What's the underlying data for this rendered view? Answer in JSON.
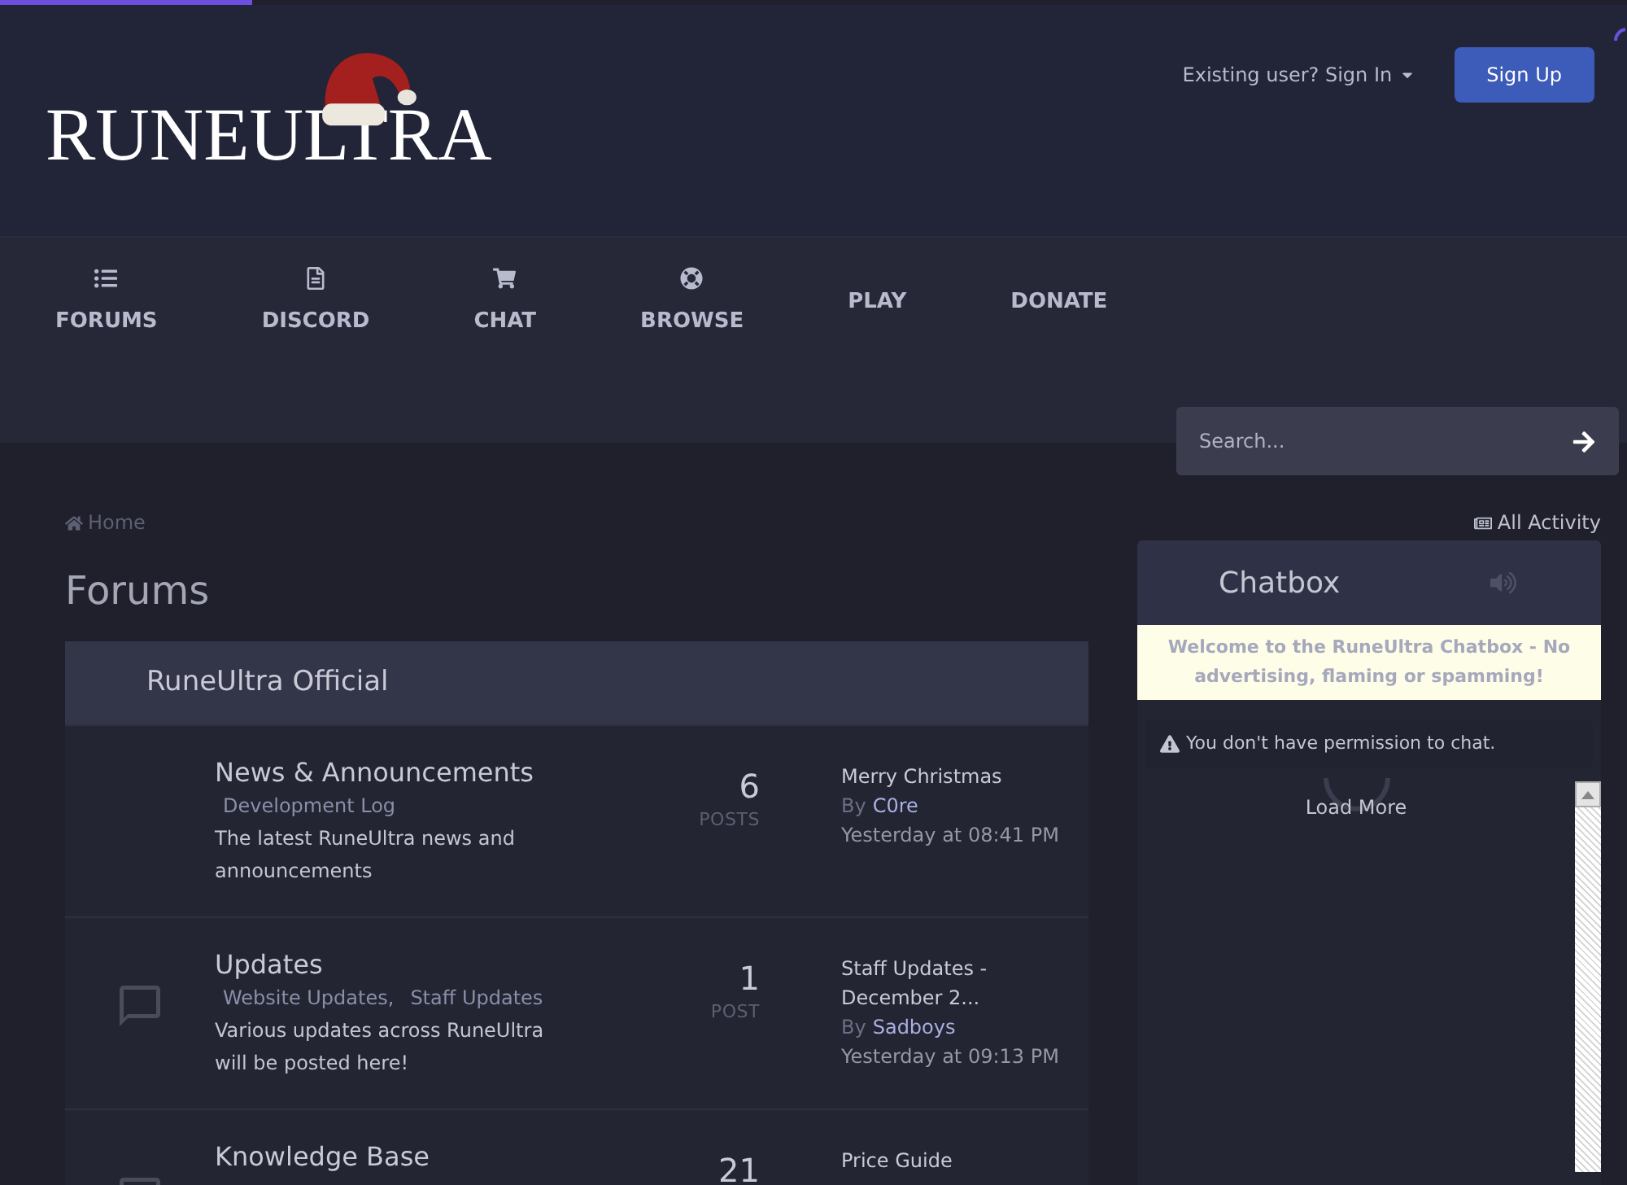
{
  "loading_bar": {
    "level": 0.155
  },
  "header": {
    "logo": "RUNEULTRA",
    "sign_in": "Existing user? Sign In",
    "sign_up": "Sign Up"
  },
  "nav": [
    {
      "label": "FORUMS",
      "kind": "icon"
    },
    {
      "label": "DISCORD",
      "kind": "icon"
    },
    {
      "label": "CHAT",
      "kind": "icon"
    },
    {
      "label": "BROWSE",
      "kind": "icon"
    },
    {
      "label": "PLAY",
      "kind": "text"
    },
    {
      "label": "DONATE",
      "kind": "text"
    }
  ],
  "search": {
    "placeholder": "Search..."
  },
  "breadcrumb": {
    "home": "Home",
    "all_activity": "All Activity"
  },
  "page_title": "Forums",
  "category": {
    "title": "RuneUltra Official",
    "forums": [
      {
        "has_icon": false,
        "name": "News & Announcements",
        "subforums": [
          "Development Log"
        ],
        "description": "The latest RuneUltra news and announcements",
        "count": "6",
        "count_label": "POSTS",
        "last_post": {
          "title": "Merry Christmas",
          "by": "By",
          "author": "C0re",
          "time": "Yesterday at 08:41 PM"
        }
      },
      {
        "has_icon": true,
        "name": "Updates",
        "subforums": [
          "Website Updates,",
          "Staff Updates"
        ],
        "description": "Various updates across RuneUltra will be posted here!",
        "count": "1",
        "count_label": "POST",
        "last_post": {
          "title": "Staff Updates - December 2...",
          "by": "By",
          "author": "Sadboys",
          "time": "Yesterday at 09:13 PM"
        }
      },
      {
        "has_icon": true,
        "name": "Knowledge Base",
        "count": "21",
        "last_post": {
          "title": "Price Guide"
        }
      }
    ]
  },
  "chatbox": {
    "title": "Chatbox",
    "notice": "Welcome to the RuneUltra Chatbox - No advertising, flaming or spamming!",
    "warning": "You don't have permission to chat.",
    "load_more": "Load More"
  }
}
